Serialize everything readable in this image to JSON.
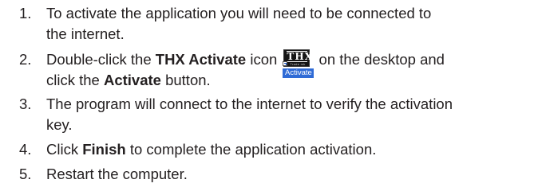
{
  "steps": [
    {
      "num": "1.",
      "lines": [
        "To activate the application you will need to be connected to",
        "the internet."
      ]
    },
    {
      "num": "2.",
      "line1_a": "Double-click the ",
      "line1_bold": "THX Activate",
      "line1_b": " icon ",
      "line1_c": " on the desktop and",
      "line2_a": "click the ",
      "line2_bold": "Activate",
      "line2_b": " button."
    },
    {
      "num": "3.",
      "lines": [
        "The program will connect to the internet to verify the activation",
        "key."
      ]
    },
    {
      "num": "4.",
      "a": "Click ",
      "bold": "Finish",
      "b": " to complete the application activation."
    },
    {
      "num": "5.",
      "text": "Restart the computer."
    }
  ],
  "thx_icon": {
    "mark": "THX",
    "sub": "Trade mk",
    "caption": "Activate"
  }
}
